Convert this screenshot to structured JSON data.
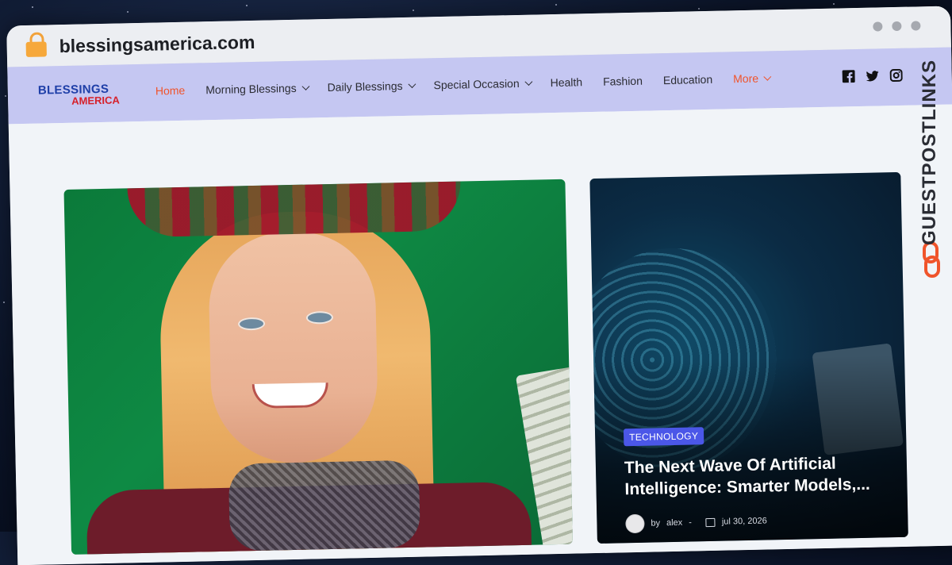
{
  "browser": {
    "url": "blessingsamerica.com"
  },
  "site": {
    "logo_line1": "BLESSINGS",
    "logo_line2": "AMERICA",
    "accent_color": "#f0542b",
    "nav_bg": "#c5c7f2"
  },
  "nav": {
    "items": [
      {
        "label": "Home",
        "active": true,
        "dropdown": false
      },
      {
        "label": "Morning Blessings",
        "active": false,
        "dropdown": true
      },
      {
        "label": "Daily Blessings",
        "active": false,
        "dropdown": true
      },
      {
        "label": "Special Occasion",
        "active": false,
        "dropdown": true
      },
      {
        "label": "Health",
        "active": false,
        "dropdown": false
      },
      {
        "label": "Fashion",
        "active": false,
        "dropdown": false
      },
      {
        "label": "Education",
        "active": false,
        "dropdown": false
      },
      {
        "label": "More",
        "active": false,
        "dropdown": true
      }
    ],
    "social_icons": [
      "facebook-icon",
      "twitter-icon",
      "instagram-icon"
    ]
  },
  "featured": {
    "right": {
      "category": "TECHNOLOGY",
      "title": "The Next Wave Of Artificial Intelligence: Smarter Models,...",
      "author_prefix": "by",
      "author": "alex",
      "separator": "-",
      "date": "jul 30, 2026",
      "badge_color": "#4b57e8"
    }
  },
  "watermark": {
    "text": "GUESTPOSTLINKS"
  }
}
